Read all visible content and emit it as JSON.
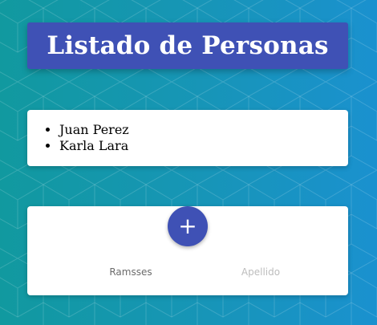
{
  "header": {
    "title": "Listado de Personas"
  },
  "personas": [
    "Juan Perez",
    "Karla Lara"
  ],
  "form": {
    "add_label": "+",
    "nombre_value": "Ramsses",
    "apellido_placeholder": "Apellido"
  },
  "colors": {
    "primary": "#3f51b5",
    "background_start": "#11999f",
    "background_end": "#1a91cf"
  }
}
